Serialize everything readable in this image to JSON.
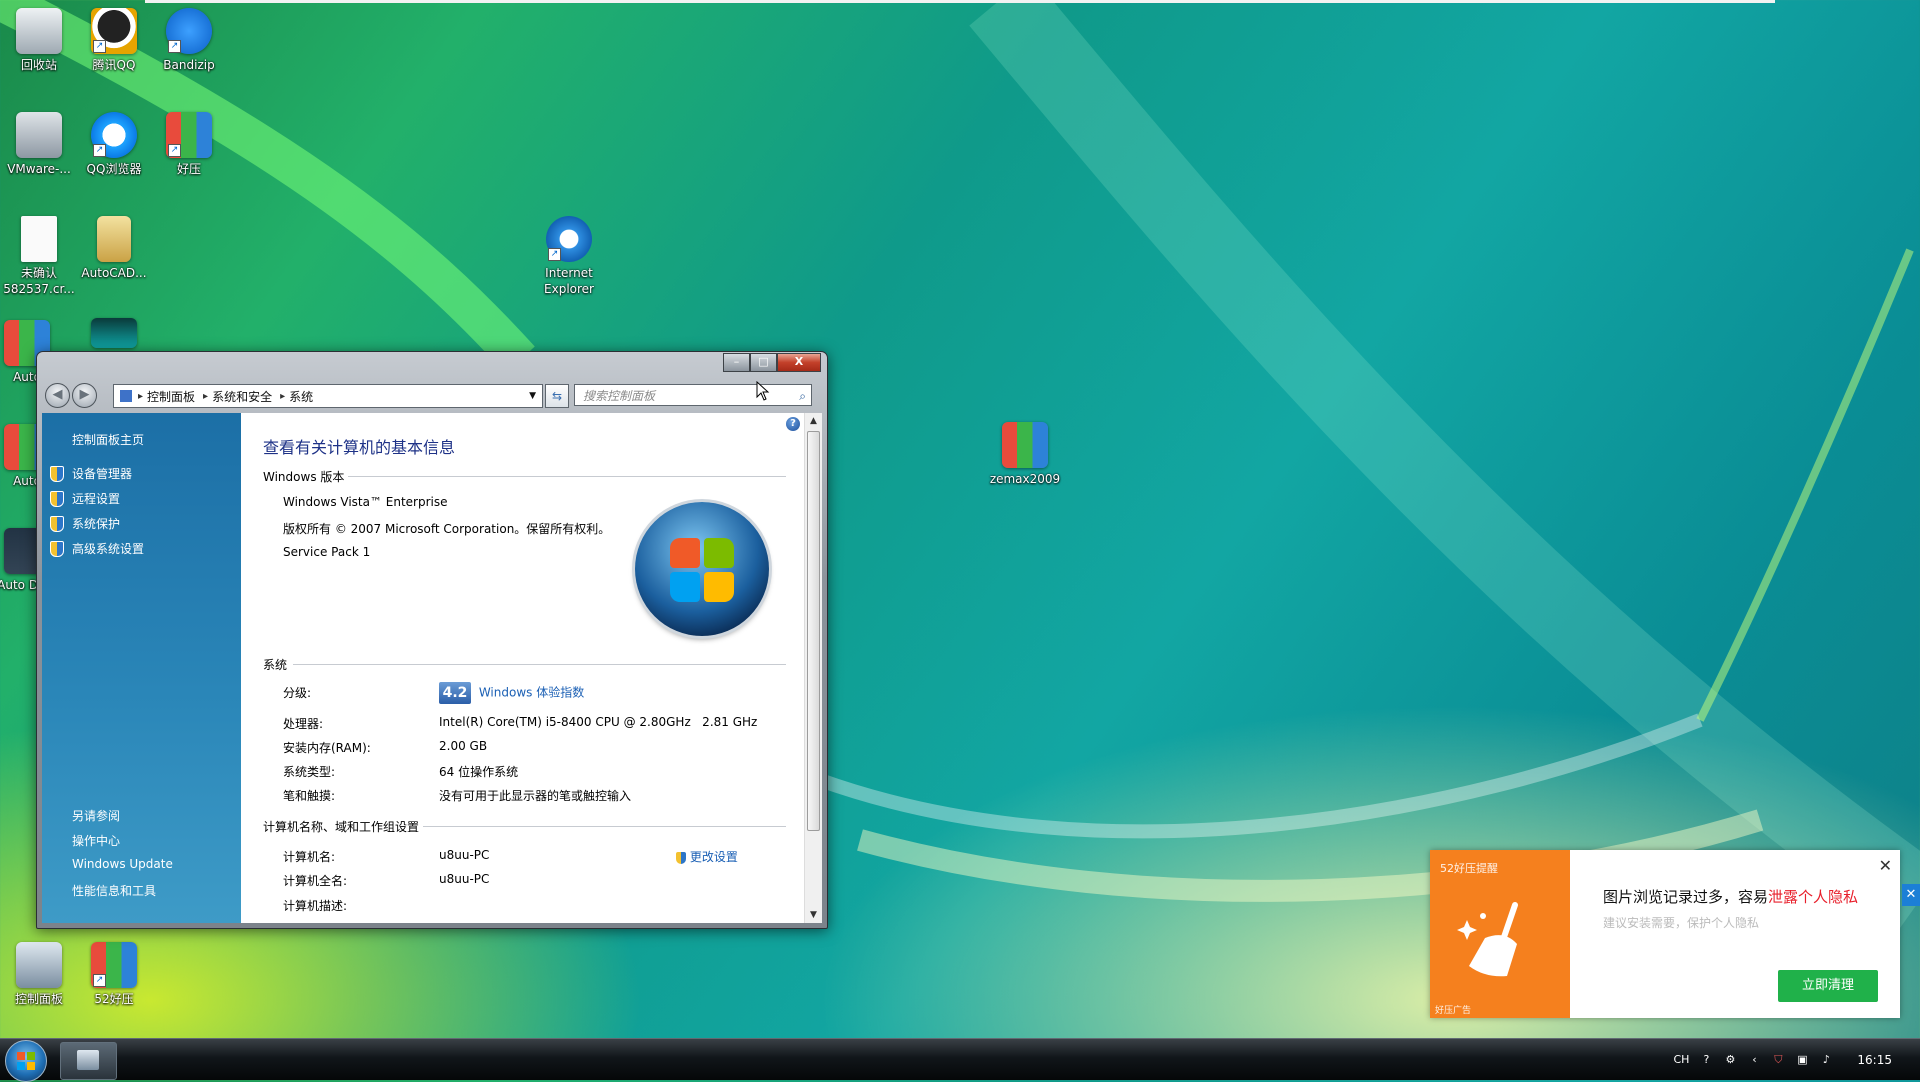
{
  "desktop": {
    "icons": [
      {
        "label": "回收站"
      },
      {
        "label": "腾讯QQ"
      },
      {
        "label": "Bandizip"
      },
      {
        "label": "VMware-..."
      },
      {
        "label": "QQ浏览器"
      },
      {
        "label": "好压"
      },
      {
        "label": "未确认 582537.cr..."
      },
      {
        "label": "AutoCAD..."
      },
      {
        "label": "Internet Explorer"
      },
      {
        "label": "Auto"
      },
      {
        "label": "Auto"
      },
      {
        "label": "Auto DWF"
      },
      {
        "label": "zemax2009"
      },
      {
        "label": "控制面板"
      },
      {
        "label": "52好压"
      }
    ]
  },
  "window": {
    "controls": {
      "minimize": "–",
      "maximize": "□",
      "close": "X"
    },
    "address": {
      "root_icon": "control-panel-icon",
      "crumbs": [
        "控制面板",
        "系统和安全",
        "系统"
      ]
    },
    "search": {
      "placeholder": "搜索控制面板"
    },
    "sidebar": {
      "home": "控制面板主页",
      "tasks": [
        "设备管理器",
        "远程设置",
        "系统保护",
        "高级系统设置"
      ],
      "see_also_title": "另请参阅",
      "see_also": [
        "操作中心",
        "Windows Update",
        "性能信息和工具"
      ]
    },
    "main": {
      "title": "查看有关计算机的基本信息",
      "edition_header": "Windows 版本",
      "edition": "Windows Vista™ Enterprise",
      "copyright": "版权所有 © 2007 Microsoft Corporation。保留所有权利。",
      "service_pack": "Service Pack 1",
      "system_header": "系统",
      "rating_label": "分级:",
      "rating_score": "4.2",
      "rating_link": "Windows 体验指数",
      "processor_label": "处理器:",
      "processor_value": "Intel(R) Core(TM) i5-8400 CPU @ 2.80GHz   2.81 GHz",
      "ram_label": "安装内存(RAM):",
      "ram_value": "2.00 GB",
      "type_label": "系统类型:",
      "type_value": "64 位操作系统",
      "pen_label": "笔和触摸:",
      "pen_value": "没有可用于此显示器的笔或触控输入",
      "computer_header": "计算机名称、域和工作组设置",
      "change_link": "更改设置",
      "name_label": "计算机名:",
      "name_value": "u8uu-PC",
      "fullname_label": "计算机全名:",
      "fullname_value": "u8uu-PC",
      "desc_label": "计算机描述:"
    }
  },
  "popup": {
    "brand": "52好压提醒",
    "ad_tag": "好压广告",
    "message_prefix": "图片浏览记录过多，容易",
    "message_highlight": "泄露个人隐私",
    "sub": "建议安装需要，保护个人隐私",
    "cta": "立即清理",
    "close": "✕"
  },
  "taskbar": {
    "tray": {
      "lang": "CH",
      "clock": "16:15"
    }
  },
  "colors": {
    "sidebar_top": "#1c6fa6",
    "title_blue": "#1e3287",
    "link_blue": "#1a5fb4",
    "popup_orange": "#f5801e",
    "popup_green": "#20b14a",
    "highlight_red": "#e8202c"
  }
}
